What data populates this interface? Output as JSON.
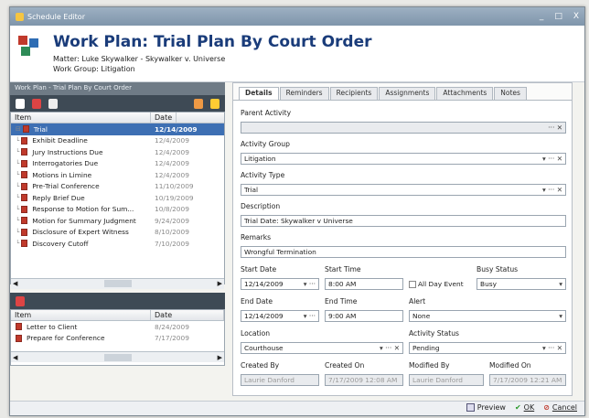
{
  "window": {
    "title": "Schedule Editor"
  },
  "header": {
    "title": "Work Plan: Trial Plan By Court Order",
    "matter": "Matter: Luke Skywalker - Skywalker v. Universe",
    "workgroup": "Work Group: Litigation"
  },
  "left": {
    "panel_title": "Work Plan - Trial Plan By Court Order",
    "col_item": "Item",
    "col_date": "Date",
    "rows": [
      {
        "item": "Trial",
        "date": "12/14/2009"
      },
      {
        "item": "Exhibit Deadline",
        "date": "12/4/2009"
      },
      {
        "item": "Jury Instructions Due",
        "date": "12/4/2009"
      },
      {
        "item": "Interrogatories Due",
        "date": "12/4/2009"
      },
      {
        "item": "Motions in Limine",
        "date": "12/4/2009"
      },
      {
        "item": "Pre-Trial Conference",
        "date": "11/10/2009"
      },
      {
        "item": "Reply Brief Due",
        "date": "10/19/2009"
      },
      {
        "item": "Response to Motion for Sum...",
        "date": "10/8/2009"
      },
      {
        "item": "Motion for Summary Judgment",
        "date": "9/24/2009"
      },
      {
        "item": "Disclosure of Expert Witness",
        "date": "8/10/2009"
      },
      {
        "item": "Discovery Cutoff",
        "date": "7/10/2009"
      }
    ],
    "bottom_col_item": "Item",
    "bottom_col_date": "Date",
    "bottom_rows": [
      {
        "item": "Letter to Client",
        "date": "8/24/2009"
      },
      {
        "item": "Prepare for Conference",
        "date": "7/17/2009"
      }
    ]
  },
  "tabs": [
    "Details",
    "Reminders",
    "Recipients",
    "Assignments",
    "Attachments",
    "Notes"
  ],
  "form": {
    "parent_activity_label": "Parent Activity",
    "parent_activity": "",
    "activity_group_label": "Activity Group",
    "activity_group": "Litigation",
    "activity_type_label": "Activity Type",
    "activity_type": "Trial",
    "description_label": "Description",
    "description": "Trial Date: Skywalker v Universe",
    "remarks_label": "Remarks",
    "remarks": "Wrongful Termination",
    "start_date_label": "Start Date",
    "start_date": "12/14/2009",
    "start_time_label": "Start Time",
    "start_time": "8:00 AM",
    "all_day_label": "All Day Event",
    "busy_status_label": "Busy Status",
    "busy_status": "Busy",
    "end_date_label": "End Date",
    "end_date": "12/14/2009",
    "end_time_label": "End Time",
    "end_time": "9:00 AM",
    "alert_label": "Alert",
    "alert": "None",
    "location_label": "Location",
    "location": "Courthouse",
    "activity_status_label": "Activity Status",
    "activity_status": "Pending",
    "created_by_label": "Created By",
    "created_by": "Laurie Danford",
    "created_on_label": "Created On",
    "created_on": "7/17/2009 12:08 AM",
    "modified_by_label": "Modified By",
    "modified_by": "Laurie Danford",
    "modified_on_label": "Modified On",
    "modified_on": "7/17/2009 12:21 AM"
  },
  "footer": {
    "preview": "Preview",
    "ok": "OK",
    "cancel": "Cancel"
  }
}
